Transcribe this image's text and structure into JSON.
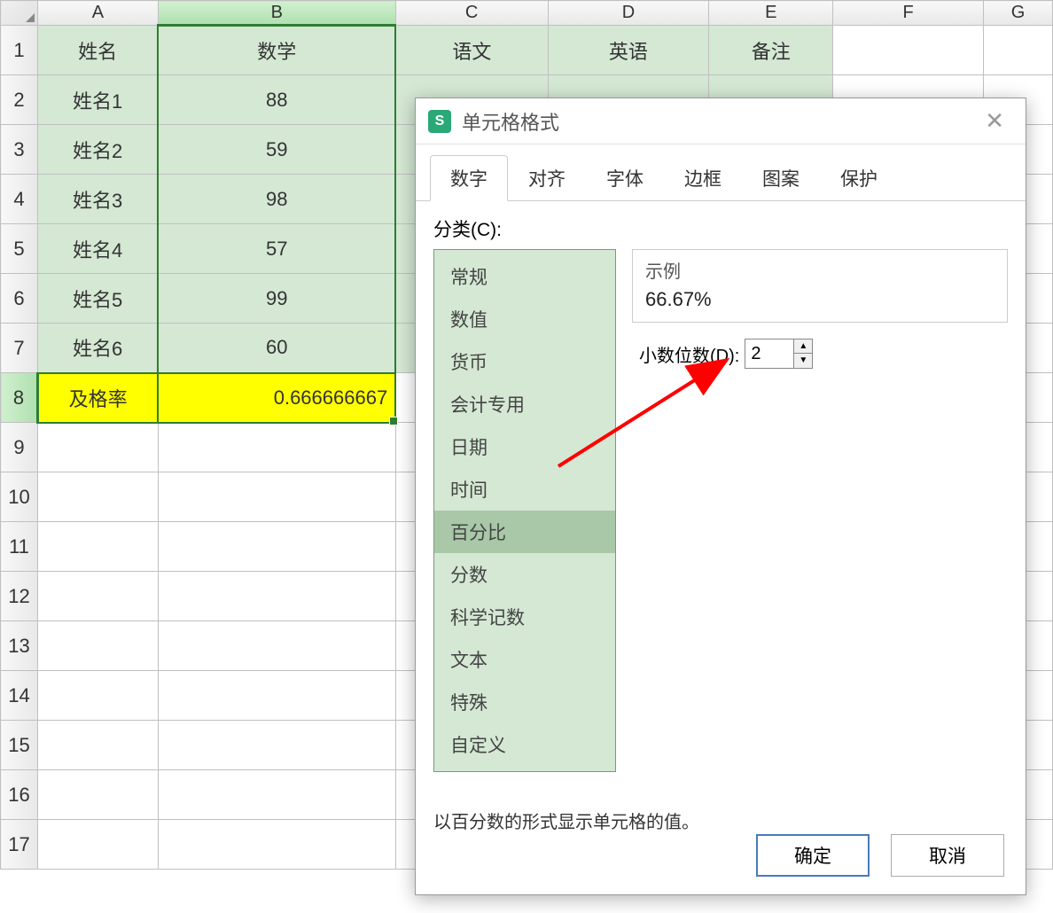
{
  "spreadsheet": {
    "columns": [
      "A",
      "B",
      "C",
      "D",
      "E",
      "F",
      "G"
    ],
    "row_numbers": [
      "1",
      "2",
      "3",
      "4",
      "5",
      "6",
      "7",
      "8",
      "9",
      "10",
      "11",
      "12",
      "13",
      "14",
      "15",
      "16",
      "17"
    ],
    "header_row": {
      "A": "姓名",
      "B": "数学",
      "C": "语文",
      "D": "英语",
      "E": "备注"
    },
    "data_rows": [
      {
        "A": "姓名1",
        "B": "88"
      },
      {
        "A": "姓名2",
        "B": "59"
      },
      {
        "A": "姓名3",
        "B": "98"
      },
      {
        "A": "姓名4",
        "B": "57"
      },
      {
        "A": "姓名5",
        "B": "99"
      },
      {
        "A": "姓名6",
        "B": "60"
      }
    ],
    "footer_row": {
      "A": "及格率",
      "B": "0.666666667"
    }
  },
  "dialog": {
    "title": "单元格格式",
    "tabs": [
      "数字",
      "对齐",
      "字体",
      "边框",
      "图案",
      "保护"
    ],
    "active_tab": "数字",
    "category_label": "分类(C):",
    "categories": [
      "常规",
      "数值",
      "货币",
      "会计专用",
      "日期",
      "时间",
      "百分比",
      "分数",
      "科学记数",
      "文本",
      "特殊",
      "自定义"
    ],
    "selected_category": "百分比",
    "sample": {
      "label": "示例",
      "value": "66.67%"
    },
    "decimal": {
      "label": "小数位数(D):",
      "value": "2"
    },
    "description": "以百分数的形式显示单元格的值。",
    "buttons": {
      "ok": "确定",
      "cancel": "取消"
    }
  }
}
